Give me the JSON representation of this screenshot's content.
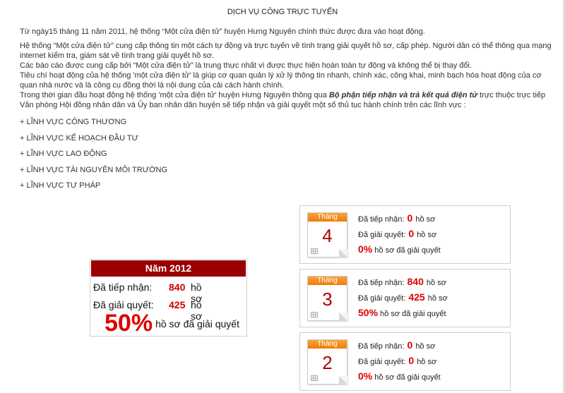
{
  "page": {
    "heading": "DỊCH VỤ CÔNG TRỰC TUYẾN",
    "intro": {
      "p1": "Từ ngày15 tháng 11 năm 2011, hệ thống “Một cửa điện tử” huyện Hưng Nguyên chính thức được đưa vào hoạt động.",
      "p2": "Hệ thống “Một cửa điện tử” cung cấp thông tin một cách tự động và trực tuyến về tình trạng giải quyết hồ sơ, cấp phép. Người dân có thể thông qua mạng internet kiểm tra, giám sát về tình trạng giải quyết hồ sơ.",
      "p3": "Các báo cáo được cung cấp bởi “Một cửa điện tử” là trung thực nhất vì được thực hiện hoàn toàn tự động và không thể bị thay đổi.",
      "p4": "Tiêu chí hoạt động của hệ thống 'một cửa điện tử' là giúp cơ quan quản lý xử lý thông tin nhanh, chính xác, công khai, minh bạch hóa hoạt động của cơ quan nhà nước và là công cụ đồng thời là nội dung của cải cách hành chính.",
      "p5_before": "Trong thời gian đầu hoạt động hệ thống 'một cửa điện tử' huyện Hưng Nguyên thông qua ",
      "p5_bold": "Bộ phận tiếp nhận và trả kết quả điện tử",
      "p5_after": " trực thuộc trực tiếp Văn phòng Hội đồng nhân dân và Ủy ban nhân dân huyện sẽ tiếp nhận và giải quyết một số thủ tục hành chính trên các lĩnh vực :"
    },
    "fields": [
      "+ LĨNH VỰC CÔNG THƯƠNG",
      "+ LĨNH VỰC KẾ HOẠCH ĐẦU TƯ",
      "+ LĨNH VỰC LAO ĐỘNG",
      "+ LĨNH VỰC TÀI NGUYÊN MÔI TRƯỜNG",
      "+ LĨNH VỰC TƯ PHÁP"
    ]
  },
  "year": {
    "title": "Năm 2012",
    "received_label": "Đã tiếp nhận:",
    "received_value": "840",
    "resolved_label": "Đã giải quyết:",
    "resolved_value": "425",
    "unit": "hồ sơ",
    "percent": "50%",
    "percent_text": "hồ sơ đã giải quyết"
  },
  "months": [
    {
      "head": "Tháng",
      "num": "4",
      "received_label": "Đã tiếp nhận:",
      "received": "0",
      "resolved_label": "Đã giải quyết:",
      "resolved": "0",
      "unit": "hồ sơ",
      "percent": "0%",
      "percent_text": "hồ sơ đã giải quyết"
    },
    {
      "head": "Tháng",
      "num": "3",
      "received_label": "Đã tiếp nhận:",
      "received": "840",
      "resolved_label": "Đã giải quyết:",
      "resolved": "425",
      "unit": "hồ sơ",
      "percent": "50%",
      "percent_text": "hồ sơ đã giải quyết"
    },
    {
      "head": "Tháng",
      "num": "2",
      "received_label": "Đã tiếp nhận:",
      "received": "0",
      "resolved_label": "Đã giải quyết:",
      "resolved": "0",
      "unit": "hồ sơ",
      "percent": "0%",
      "percent_text": "hồ sơ đã giải quyết"
    }
  ],
  "icons": {
    "calendar": "calendar-icon",
    "grid": "grid-icon"
  },
  "colors": {
    "accent_red": "#dd0000",
    "year_header": "#990000",
    "calendar_orange": "#ef7d0c"
  }
}
